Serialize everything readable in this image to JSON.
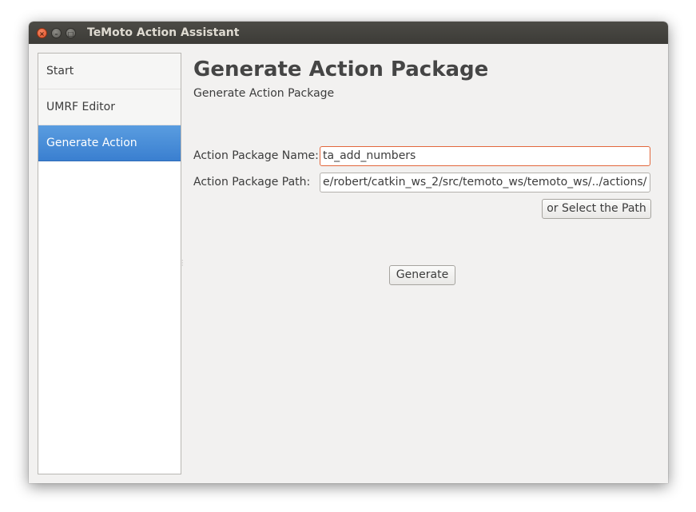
{
  "window": {
    "title": "TeMoto Action Assistant",
    "close_glyph": "×",
    "min_glyph": "–",
    "max_glyph": "□"
  },
  "sidebar": {
    "items": [
      {
        "label": "Start",
        "active": false
      },
      {
        "label": "UMRF Editor",
        "active": false
      },
      {
        "label": "Generate Action",
        "active": true
      }
    ]
  },
  "main": {
    "heading": "Generate Action Package",
    "subheading": "Generate Action Package",
    "package_name": {
      "label": "Action Package Name:",
      "value": "ta_add_numbers"
    },
    "package_path": {
      "label": "Action Package Path:",
      "value": "e/robert/catkin_ws_2/src/temoto_ws/temoto_ws/../actions/"
    },
    "select_path_button": "or Select the Path",
    "generate_button": "Generate"
  },
  "colors": {
    "titlebar": "#3c3b37",
    "window_bg": "#f2f1f0",
    "active_item": "#4a8fdb",
    "focus_border": "#e2673c",
    "close_button": "#e0522a"
  },
  "icons": {
    "close": "close-icon",
    "minimize": "minimize-icon",
    "maximize": "maximize-icon"
  }
}
